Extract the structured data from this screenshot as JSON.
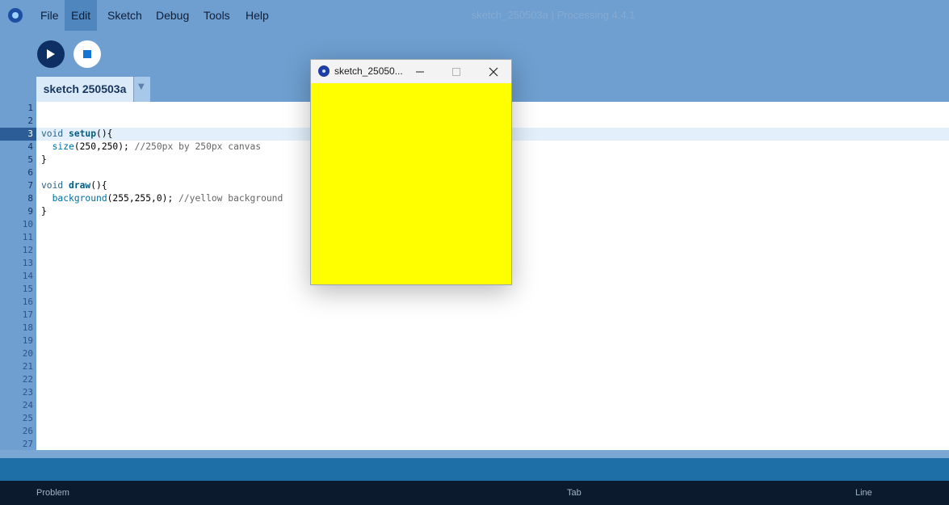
{
  "app": {
    "window_title": "sketch_250503a | Processing 4.4.1",
    "menu": [
      "File",
      "Edit",
      "Sketch",
      "Debug",
      "Tools",
      "Help"
    ],
    "active_menu": "Edit"
  },
  "toolbar": {
    "run_icon": "play-icon",
    "stop_icon": "stop-icon"
  },
  "tabs": [
    {
      "label": "sketch 250503a"
    }
  ],
  "editor": {
    "current_line": 3,
    "line_numbers": [
      "1",
      "2",
      "3",
      "4",
      "5",
      "6",
      "7",
      "8",
      "9",
      "10",
      "11",
      "12",
      "13",
      "14",
      "15",
      "16",
      "17",
      "18",
      "19",
      "20",
      "21",
      "22",
      "23",
      "24",
      "25",
      "26",
      "27"
    ],
    "code": {
      "l3": {
        "kw": "void",
        "fn": "setup",
        "rest": "(){"
      },
      "l4": {
        "fn": "size",
        "args": "(250,250);",
        "comment": "//250px by 250px canvas"
      },
      "l5": "}",
      "l7": {
        "kw": "void",
        "fn": "draw",
        "rest": "(){"
      },
      "l8": {
        "fn": "background",
        "args": "(255,255,0);",
        "comment": "//yellow background"
      },
      "l9": "}"
    }
  },
  "status": {
    "problem": "Problem",
    "tab": "Tab",
    "line": "Line"
  },
  "sketch_window": {
    "title": "sketch_25050...",
    "background_color": "#ffff00"
  },
  "colors": {
    "editor_bg": "#ffffff",
    "chrome": "#6e9fd0",
    "status_bar": "#0b1a2c",
    "accent": "#0d2f63"
  }
}
